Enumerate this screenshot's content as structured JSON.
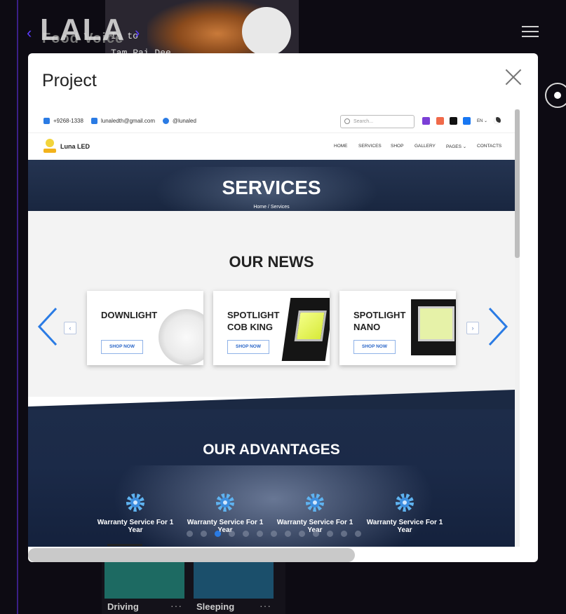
{
  "background": {
    "brand": "LALA",
    "brand_sub": "Food Voice",
    "food_text_line1": "In to",
    "food_text_line2": "Tam Rai Dee",
    "tiles": [
      {
        "label": "Driving",
        "dots": "···"
      },
      {
        "label": "Sleeping",
        "dots": "···"
      }
    ]
  },
  "modal": {
    "title": "Project"
  },
  "site": {
    "topbar": {
      "phone": "+9268-1338",
      "email": "lunaledth@gmail.com",
      "line": "@lunaled",
      "search_placeholder": "Search...",
      "lang": "EN ⌄"
    },
    "brand": "Luna LED",
    "nav": [
      "HOME",
      "SERVICES",
      "SHOP",
      "GALLERY",
      "PAGES ⌄",
      "CONTACTS"
    ],
    "hero": {
      "title": "SERVICES",
      "crumb": "Home  /  Services"
    },
    "news": {
      "title": "OUR NEWS",
      "cards": [
        {
          "title": "DOWNLIGHT",
          "button": "SHOP NOW"
        },
        {
          "title": "SPOTLIGHT COB KING",
          "button": "SHOP NOW"
        },
        {
          "title": "SPOTLIGHT NANO",
          "button": "SHOP NOW"
        }
      ],
      "prev": "‹",
      "next": "›"
    },
    "advantages": {
      "title": "OUR ADVANTAGES",
      "items": [
        {
          "text": "Warranty Service For 1 Year"
        },
        {
          "text": "Warranty Service For 1 Year"
        },
        {
          "text": "Warranty Service For 1 Year"
        },
        {
          "text": "Warranty Service For 1 Year"
        }
      ]
    }
  },
  "carousel": {
    "slide_count": 13,
    "active_index": 2
  },
  "colors": {
    "accent": "#2a7be4",
    "page_bg": "#0d0b13",
    "side_line": "#3a1f86"
  }
}
